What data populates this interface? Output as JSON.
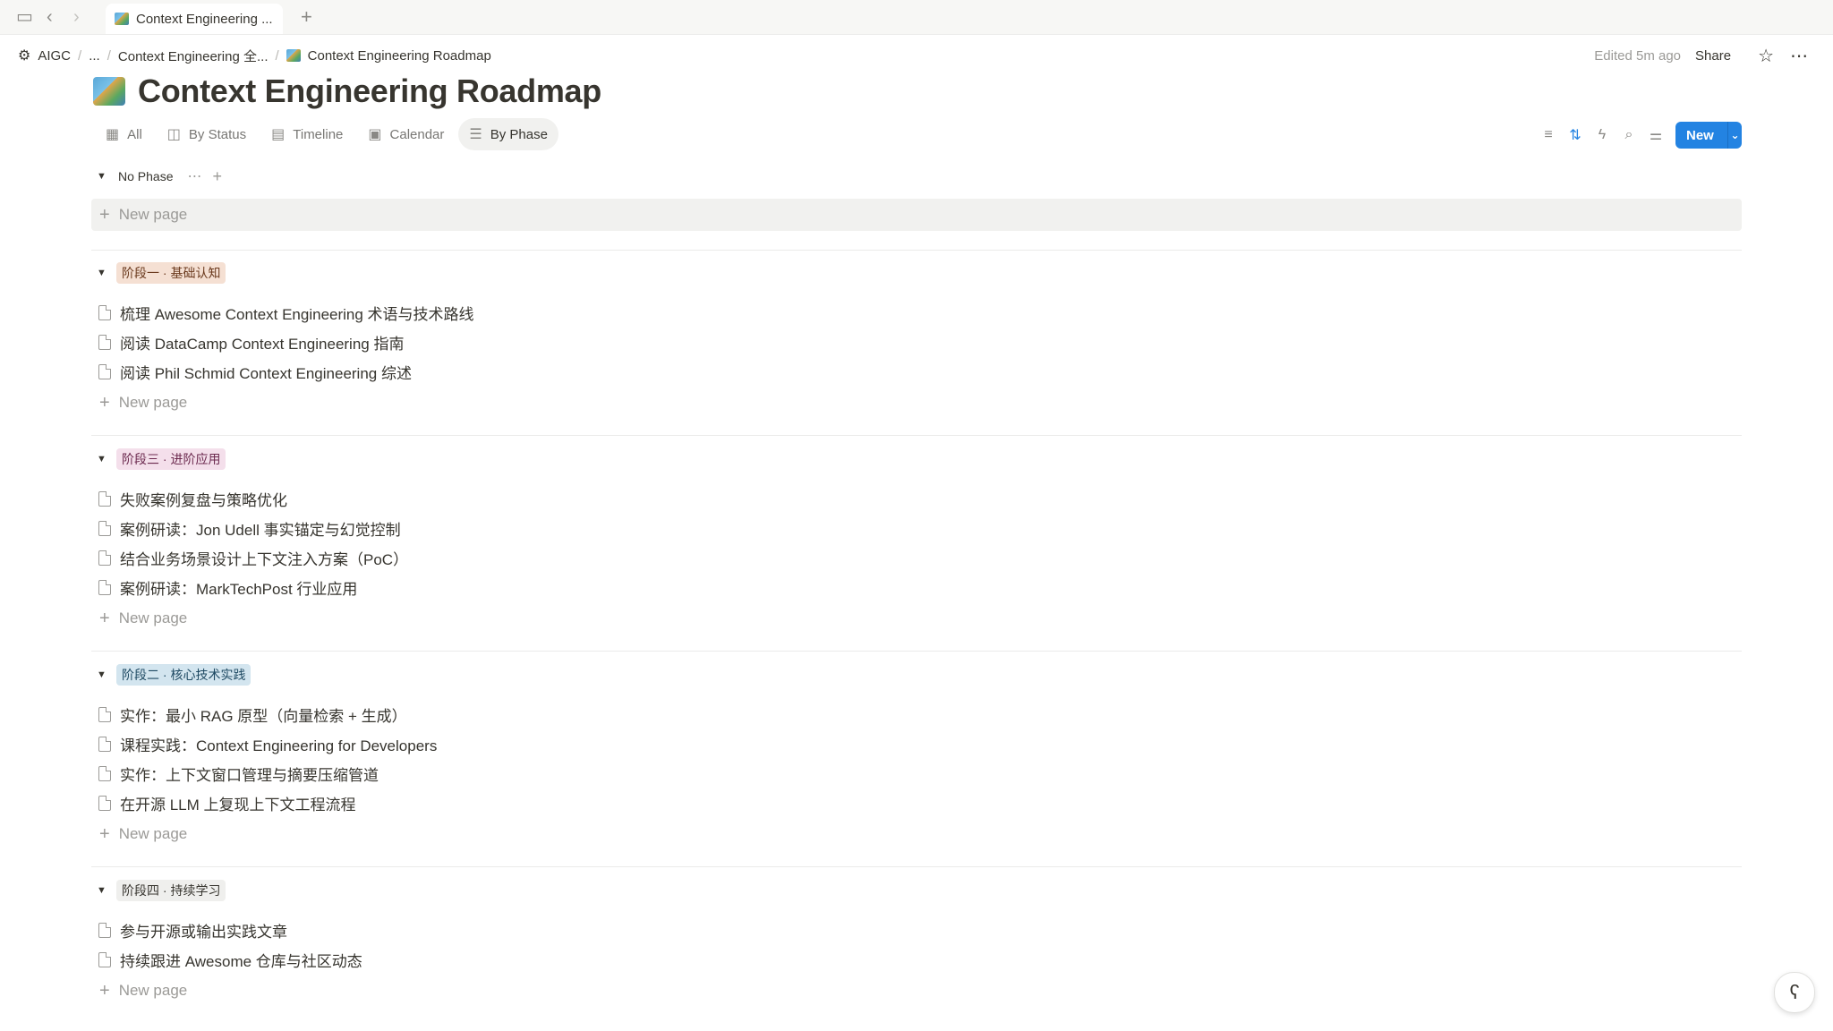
{
  "browser": {
    "tab_title": "Context Engineering ...",
    "new_tab_icon": "plus-icon"
  },
  "breadcrumb": {
    "workspace": "AIGC",
    "ellipsis": "...",
    "parent": "Context Engineering 全...",
    "current": "Context Engineering Roadmap"
  },
  "topbar": {
    "edited": "Edited 5m ago",
    "share": "Share"
  },
  "page": {
    "title": "Context Engineering Roadmap"
  },
  "views": [
    {
      "label": "All",
      "icon": "table-icon"
    },
    {
      "label": "By Status",
      "icon": "board-icon"
    },
    {
      "label": "Timeline",
      "icon": "timeline-icon"
    },
    {
      "label": "Calendar",
      "icon": "calendar-icon"
    },
    {
      "label": "By Phase",
      "icon": "list-icon",
      "active": true
    }
  ],
  "toolbar": {
    "new_label": "New"
  },
  "new_page_label": "New page",
  "groups": [
    {
      "name": "No Phase",
      "items": []
    },
    {
      "name": "阶段一 · 基础认知",
      "color": "#f5e0d3",
      "items": [
        "梳理 Awesome Context Engineering 术语与技术路线",
        "阅读 DataCamp Context Engineering 指南",
        "阅读 Phil Schmid Context Engineering 综述"
      ]
    },
    {
      "name": "阶段三 · 进阶应用",
      "color": "#f4dfeb",
      "items": [
        "失败案例复盘与策略优化",
        "案例研读：Jon Udell 事实锚定与幻觉控制",
        "结合业务场景设计上下文注入方案（PoC）",
        "案例研读：MarkTechPost 行业应用"
      ]
    },
    {
      "name": "阶段二 · 核心技术实践",
      "color": "#d3e5ef",
      "items": [
        "实作：最小 RAG 原型（向量检索 + 生成）",
        "课程实践：Context Engineering for Developers",
        "实作：上下文窗口管理与摘要压缩管道",
        "在开源 LLM 上复现上下文工程流程"
      ]
    },
    {
      "name": "阶段四 · 持续学习",
      "color": "#efefed",
      "items": [
        "参与开源或输出实践文章",
        "持续跟进 Awesome 仓库与社区动态"
      ]
    }
  ]
}
